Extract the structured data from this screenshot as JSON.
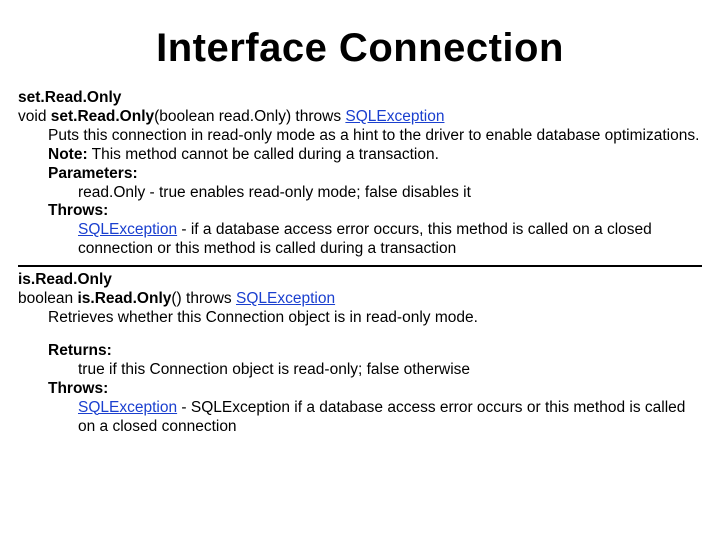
{
  "title": "Interface Connection",
  "m1": {
    "name": "set.Read.Only",
    "sig_pre": "void ",
    "sig_bold": "set.Read.Only",
    "sig_mid": "(boolean read.Only) throws ",
    "sig_link": "SQLException",
    "desc_pre": "Puts this connection in read-only mode as a hint to the driver to enable database optimizations. ",
    "desc_note_label": "Note:",
    "desc_note_text": " This method cannot be called during a transaction.",
    "params_label": "Parameters:",
    "params_text": "read.Only - true enables read-only mode; false disables it",
    "throws_label": "Throws:",
    "throws_link": "SQLException",
    "throws_text": " - if a database access error occurs, this method is called on a closed connection or this method is called during a transaction"
  },
  "m2": {
    "name": "is.Read.Only",
    "sig_pre": "boolean ",
    "sig_bold": "is.Read.Only",
    "sig_mid": "() throws ",
    "sig_link": "SQLException",
    "desc": "Retrieves whether this Connection object is in read-only mode.",
    "returns_label": "Returns:",
    "returns_text": "true if this Connection object is read-only; false otherwise",
    "throws_label": "Throws:",
    "throws_link": "SQLException",
    "throws_text": " - SQLException if a database access error occurs or this method is called on a closed connection"
  }
}
